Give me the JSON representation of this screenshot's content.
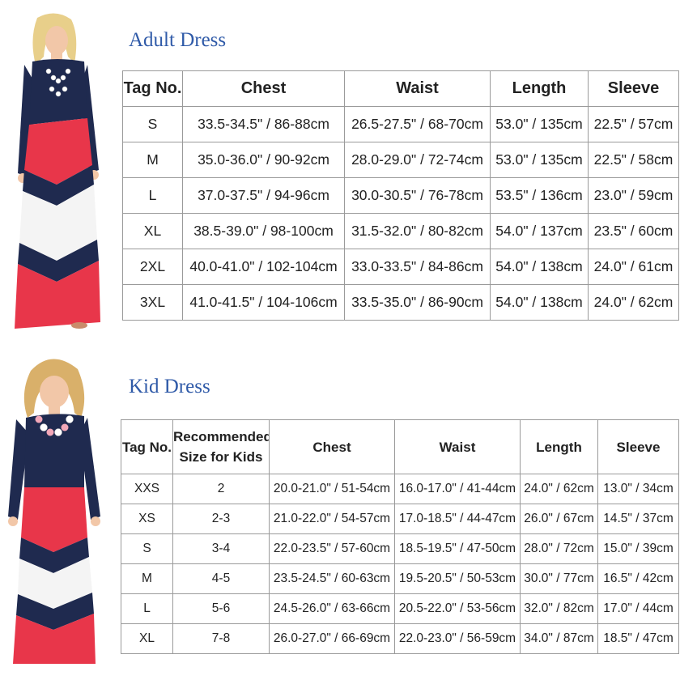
{
  "adult": {
    "title": "Adult Dress",
    "headers": [
      "Tag No.",
      "Chest",
      "Waist",
      "Length",
      "Sleeve"
    ],
    "rows": [
      [
        "S",
        "33.5-34.5\" / 86-88cm",
        "26.5-27.5\" / 68-70cm",
        "53.0\" / 135cm",
        "22.5\" / 57cm"
      ],
      [
        "M",
        "35.0-36.0\" / 90-92cm",
        "28.0-29.0\" / 72-74cm",
        "53.0\" / 135cm",
        "22.5\" / 58cm"
      ],
      [
        "L",
        "37.0-37.5\" / 94-96cm",
        "30.0-30.5\" / 76-78cm",
        "53.5\" / 136cm",
        "23.0\" / 59cm"
      ],
      [
        "XL",
        "38.5-39.0\" / 98-100cm",
        "31.5-32.0\" / 80-82cm",
        "54.0\" / 137cm",
        "23.5\" / 60cm"
      ],
      [
        "2XL",
        "40.0-41.0\" / 102-104cm",
        "33.0-33.5\" / 84-86cm",
        "54.0\" / 138cm",
        "24.0\" / 61cm"
      ],
      [
        "3XL",
        "41.0-41.5\" / 104-106cm",
        "33.5-35.0\" / 86-90cm",
        "54.0\" / 138cm",
        "24.0\" / 62cm"
      ]
    ]
  },
  "kid": {
    "title": "Kid Dress",
    "headers": [
      "Tag No.",
      "Recommended Size for Kids",
      "Chest",
      "Waist",
      "Length",
      "Sleeve"
    ],
    "rows": [
      [
        "XXS",
        "2",
        "20.0-21.0\" / 51-54cm",
        "16.0-17.0\" / 41-44cm",
        "24.0\" / 62cm",
        "13.0\" / 34cm"
      ],
      [
        "XS",
        "2-3",
        "21.0-22.0\" / 54-57cm",
        "17.0-18.5\" / 44-47cm",
        "26.0\" / 67cm",
        "14.5\" / 37cm"
      ],
      [
        "S",
        "3-4",
        "22.0-23.5\" / 57-60cm",
        "18.5-19.5\" / 47-50cm",
        "28.0\" / 72cm",
        "15.0\" / 39cm"
      ],
      [
        "M",
        "4-5",
        "23.5-24.5\" / 60-63cm",
        "19.5-20.5\" / 50-53cm",
        "30.0\" / 77cm",
        "16.5\" / 42cm"
      ],
      [
        "L",
        "5-6",
        "24.5-26.0\" / 63-66cm",
        "20.5-22.0\" / 53-56cm",
        "32.0\" / 82cm",
        "17.0\" / 44cm"
      ],
      [
        "XL",
        "7-8",
        "26.0-27.0\" / 66-69cm",
        "22.0-23.0\" / 56-59cm",
        "34.0\" / 87cm",
        "18.5\" / 47cm"
      ]
    ]
  },
  "colors": {
    "title": "#2f5aa8",
    "navy": "#1f2a4f",
    "red": "#e8364a",
    "white": "#f4f4f4",
    "skin": "#f2c7a8",
    "hair": "#e8cf8a"
  }
}
